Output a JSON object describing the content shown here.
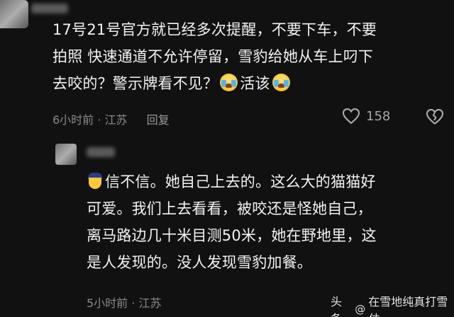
{
  "comments": [
    {
      "lines": [
        "17号21号官方就已经多次提醒，不要下车，不要",
        "拍照 快速通道不允许停留，雪豹给她从车上叼下",
        "去咬的？警示牌看不见？",
        "活该"
      ],
      "emoji": "crying-laughing-face",
      "time": "6小时前",
      "location": "江苏",
      "reply_label": "回复",
      "likes": "158"
    },
    {
      "lines": [
        "信不信。她自己上去的。这么大的猫猫好",
        "可爱。我们上去看看，被咬还是怪她自己，",
        "离马路边几十米目测50米，她在野地里，这",
        "是人发现的。没人发现雪豹加餐。"
      ],
      "emoji": "police-officer-face",
      "time": "5小时前",
      "location": "江苏"
    }
  ],
  "separator": "·",
  "watermark": {
    "source": "头条",
    "account": "在雪地纯真打雪仗",
    "at_symbol": "@"
  }
}
